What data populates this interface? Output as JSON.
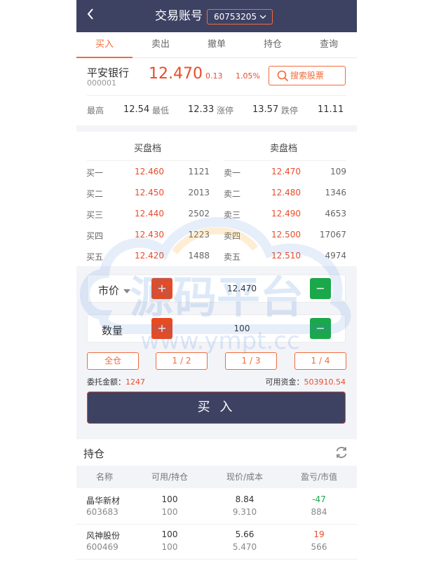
{
  "header": {
    "back_icon": "chevron-left-icon",
    "title": "交易账号",
    "account": "60753205"
  },
  "tabs": [
    {
      "label": "买入",
      "active": true
    },
    {
      "label": "卖出",
      "active": false
    },
    {
      "label": "撤单",
      "active": false
    },
    {
      "label": "持仓",
      "active": false
    },
    {
      "label": "查询",
      "active": false
    }
  ],
  "stock": {
    "name": "平安银行",
    "code": "000001",
    "price": "12.470",
    "change": "0.13",
    "change_pct": "1.05%",
    "search_label": "搜索股票",
    "high_label": "最高",
    "high": "12.54",
    "low_label": "最低",
    "low": "12.33",
    "limit_up_label": "涨停",
    "limit_up": "13.57",
    "limit_down_label": "跌停",
    "limit_down": "11.11"
  },
  "order_book": {
    "bid_title": "买盘档",
    "ask_title": "卖盘档",
    "bids": [
      {
        "level": "买一",
        "price": "12.460",
        "volume": "1121"
      },
      {
        "level": "买二",
        "price": "12.450",
        "volume": "2013"
      },
      {
        "level": "买三",
        "price": "12.440",
        "volume": "2502"
      },
      {
        "level": "买四",
        "price": "12.430",
        "volume": "1223"
      },
      {
        "level": "买五",
        "price": "12.420",
        "volume": "1488"
      }
    ],
    "asks": [
      {
        "level": "卖一",
        "price": "12.470",
        "volume": "109"
      },
      {
        "level": "卖二",
        "price": "12.480",
        "volume": "1346"
      },
      {
        "level": "卖三",
        "price": "12.490",
        "volume": "4653"
      },
      {
        "level": "卖四",
        "price": "12.500",
        "volume": "17067"
      },
      {
        "level": "卖五",
        "price": "12.510",
        "volume": "4974"
      }
    ]
  },
  "order_form": {
    "price_type": "市价",
    "price_value": "12.470",
    "qty_label": "数量",
    "qty_value": "100",
    "plus": "+",
    "minus": "−",
    "fractions": [
      "全仓",
      "1 / 2",
      "1 / 3",
      "1 / 4"
    ],
    "amount_label": "委托金额：",
    "amount": "1247",
    "funds_label": "可用资金：",
    "funds": "503910.54",
    "buy_label": "买 入"
  },
  "positions": {
    "title": "持仓",
    "refresh_icon": "refresh-icon",
    "headers": [
      "名称",
      "可用/持仓",
      "现价/成本",
      "盈亏/市值"
    ],
    "rows": [
      {
        "name": "晶华新材",
        "code": "603683",
        "available": "100",
        "holding": "100",
        "price": "8.84",
        "cost": "9.310",
        "pnl": "-47",
        "value": "884",
        "pnl_color": "#1ba84a"
      },
      {
        "name": "风神股份",
        "code": "600469",
        "available": "100",
        "holding": "100",
        "price": "5.66",
        "cost": "5.470",
        "pnl": "19",
        "value": "566",
        "pnl_color": "#e94b2b"
      }
    ]
  },
  "watermark": {
    "text": "源码平台",
    "url": "www.ympt.cc"
  },
  "colors": {
    "header_bg": "#3d4263",
    "accent": "#f26b3a",
    "up": "#e94b2b",
    "down": "#1ba84a"
  }
}
